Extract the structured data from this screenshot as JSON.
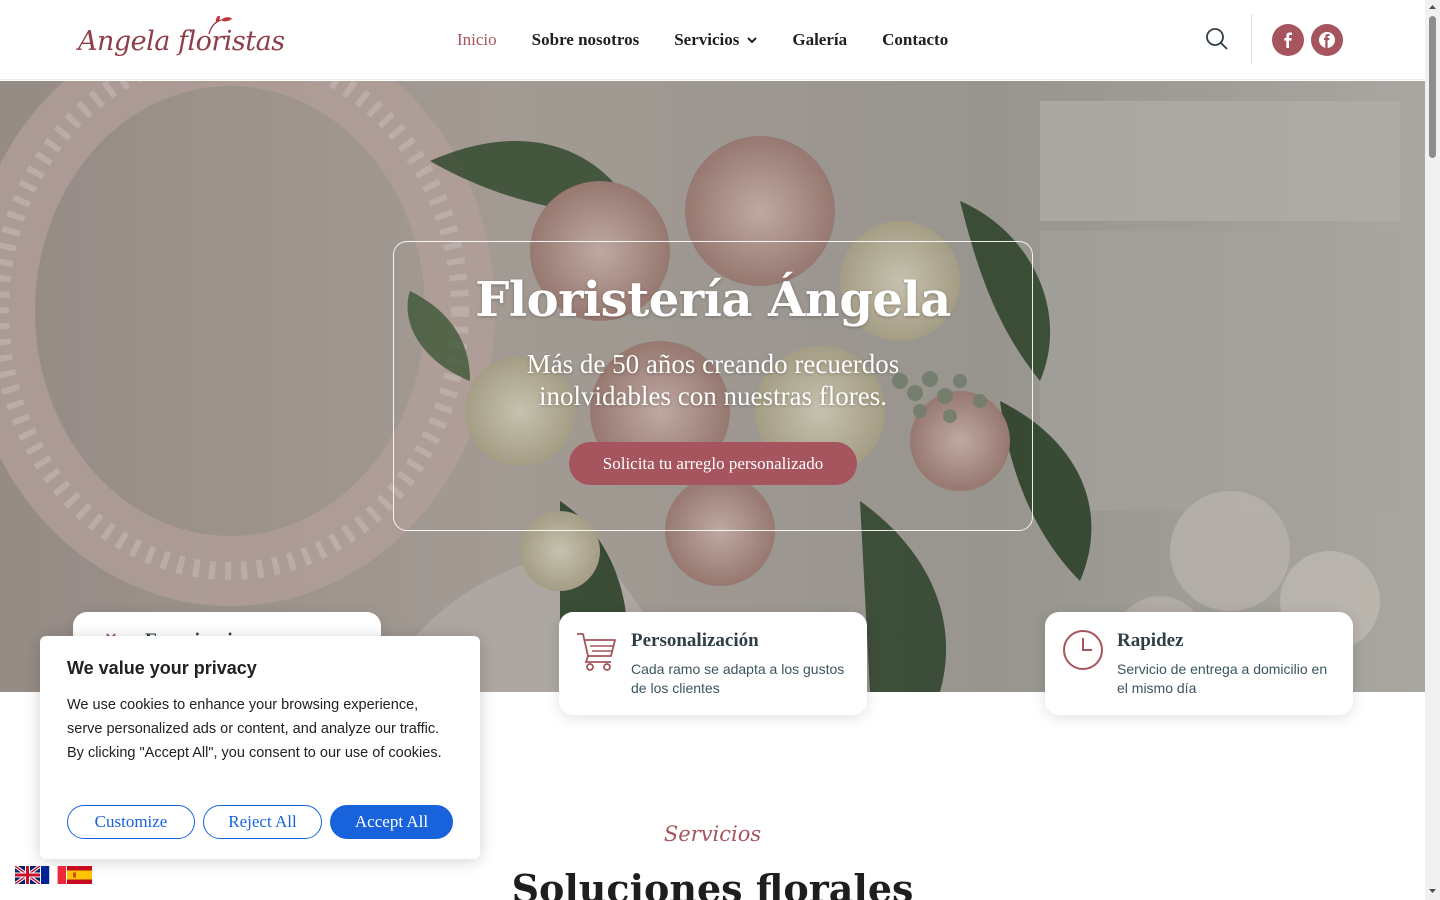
{
  "header": {
    "logo_text": "Angela floristas",
    "nav": [
      {
        "label": "Inicio",
        "active": true
      },
      {
        "label": "Sobre nosotros"
      },
      {
        "label": "Servicios",
        "has_dropdown": true
      },
      {
        "label": "Galería"
      },
      {
        "label": "Contacto"
      }
    ],
    "search_icon": "search-icon",
    "social": [
      "facebook-icon",
      "facebook-circle-icon"
    ]
  },
  "hero": {
    "title": "Floristería Ángela",
    "subtitle": "Más de 50 años creando recuerdos inolvidables con nuestras flores.",
    "cta": "Solicita tu arreglo personalizado"
  },
  "features": [
    {
      "icon": "flower-icon",
      "title": "Experiencia",
      "desc": ""
    },
    {
      "icon": "cart-icon",
      "title": "Personalización",
      "desc": "Cada ramo se adapta a los gustos de los clientes"
    },
    {
      "icon": "clock-icon",
      "title": "Rapidez",
      "desc": "Servicio de entrega a domicilio en el mismo día"
    }
  ],
  "services": {
    "kicker": "Servicios",
    "title": "Soluciones florales"
  },
  "cookie": {
    "title": "We value your privacy",
    "text": "We use cookies to enhance your browsing experience, serve personalized ads or content, and analyze our traffic. By clicking \"Accept All\", you consent to our use of cookies.",
    "customize": "Customize",
    "reject": "Reject All",
    "accept": "Accept All"
  },
  "languages": [
    "English",
    "Français",
    "Español"
  ],
  "colors": {
    "brand": "#a6545d",
    "cookie_accent": "#1863dc",
    "text_dark": "#2f3f47"
  }
}
